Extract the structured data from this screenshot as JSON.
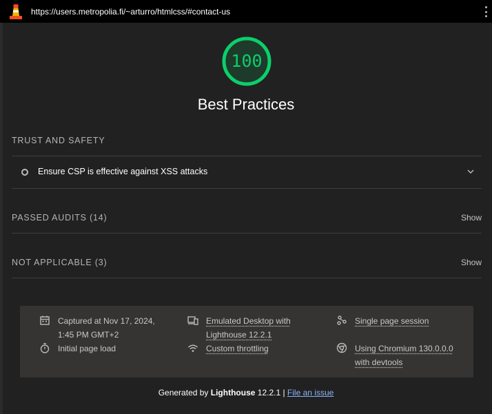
{
  "browser": {
    "url": "https://users.metropolia.fi/~arturro/htmlcss/#contact-us"
  },
  "category": {
    "score": "100",
    "title": "Best Practices",
    "score_color": "#0cce6b"
  },
  "groups": {
    "trust_safety": {
      "label": "TRUST AND SAFETY",
      "audit_title": "Ensure CSP is effective against XSS attacks"
    },
    "passed": {
      "label": "PASSED AUDITS (14)",
      "toggle": "Show"
    },
    "not_applicable": {
      "label": "NOT APPLICABLE (3)",
      "toggle": "Show"
    }
  },
  "environment": {
    "captured_line1": "Captured at Nov 17, 2024,",
    "captured_line2": "1:45 PM GMT+2",
    "page_load": "Initial page load",
    "device_line1": "Emulated Desktop with",
    "device_line2": "Lighthouse 12.2.1",
    "throttling": "Custom throttling",
    "session": "Single page session",
    "browser_line1": "Using Chromium 130.0.0.0",
    "browser_line2": "with devtools"
  },
  "footer": {
    "prefix": "Generated by ",
    "brand": "Lighthouse",
    "version": " 12.2.1 | ",
    "issue_link": "File an issue"
  },
  "icons": {
    "logo": "lighthouse-logo-icon",
    "menu": "kebab-menu-icon",
    "calendar": "calendar-icon",
    "timer": "stopwatch-icon",
    "device": "devices-icon",
    "network": "wifi-icon",
    "session": "nodes-icon",
    "chrome": "chrome-icon",
    "chevron": "chevron-down-icon"
  }
}
